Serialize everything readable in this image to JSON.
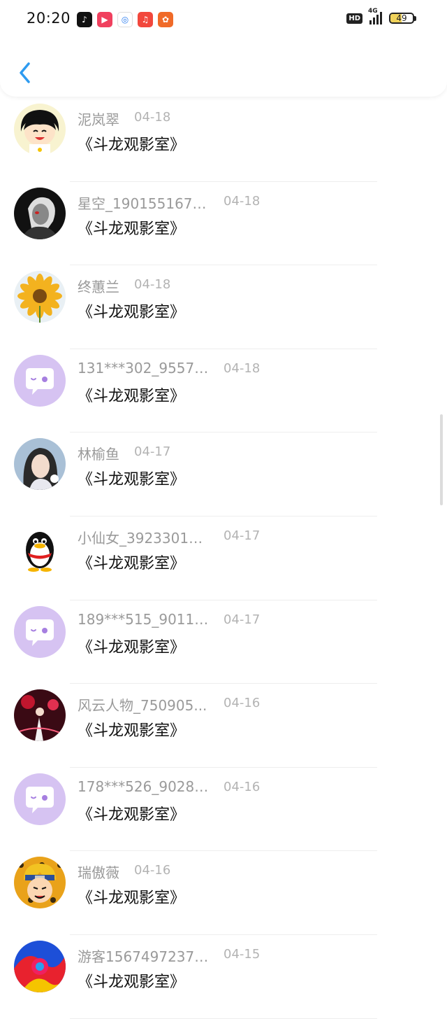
{
  "status_bar": {
    "time": "20:20",
    "network": "4G",
    "hd": "HD",
    "battery": "49",
    "battery_level": 0.49,
    "app_icons": [
      "tiktok-icon",
      "video-icon",
      "browser-icon",
      "music-icon",
      "apps-icon"
    ]
  },
  "header": {
    "back_icon": "chevron-left-icon"
  },
  "list": [
    {
      "name": "泥岚翠",
      "date": "04-18",
      "message": "《斗龙观影室》",
      "avatar": "cartoon-girl"
    },
    {
      "name": "星空_1901551678...",
      "date": "04-18",
      "message": "《斗龙观影室》",
      "avatar": "dark-portrait"
    },
    {
      "name": "终蕙兰",
      "date": "04-18",
      "message": "《斗龙观影室》",
      "avatar": "sunflower"
    },
    {
      "name": "131***302_95571...",
      "date": "04-18",
      "message": "《斗龙观影室》",
      "avatar": "chat-bubble"
    },
    {
      "name": "林榆鱼",
      "date": "04-17",
      "message": "《斗龙观影室》",
      "avatar": "girl-photo"
    },
    {
      "name": "小仙女_39233013...",
      "date": "04-17",
      "message": "《斗龙观影室》",
      "avatar": "penguin"
    },
    {
      "name": "189***515_90117...",
      "date": "04-17",
      "message": "《斗龙观影室》",
      "avatar": "chat-bubble"
    },
    {
      "name": "风云人物_750905...",
      "date": "04-16",
      "message": "《斗龙观影室》",
      "avatar": "dancer-red"
    },
    {
      "name": "178***526_90287...",
      "date": "04-16",
      "message": "《斗龙观影室》",
      "avatar": "chat-bubble"
    },
    {
      "name": "瑞傲薇",
      "date": "04-16",
      "message": "《斗龙观影室》",
      "avatar": "anime-boy"
    },
    {
      "name": "游客15674972378...",
      "date": "04-15",
      "message": "《斗龙观影室》",
      "avatar": "colorful-swirl"
    }
  ],
  "colors": {
    "accent": "#2e9bf0",
    "chat_avatar_bg": "#d6c3f2",
    "chat_avatar_icon": "#a67fe0"
  }
}
